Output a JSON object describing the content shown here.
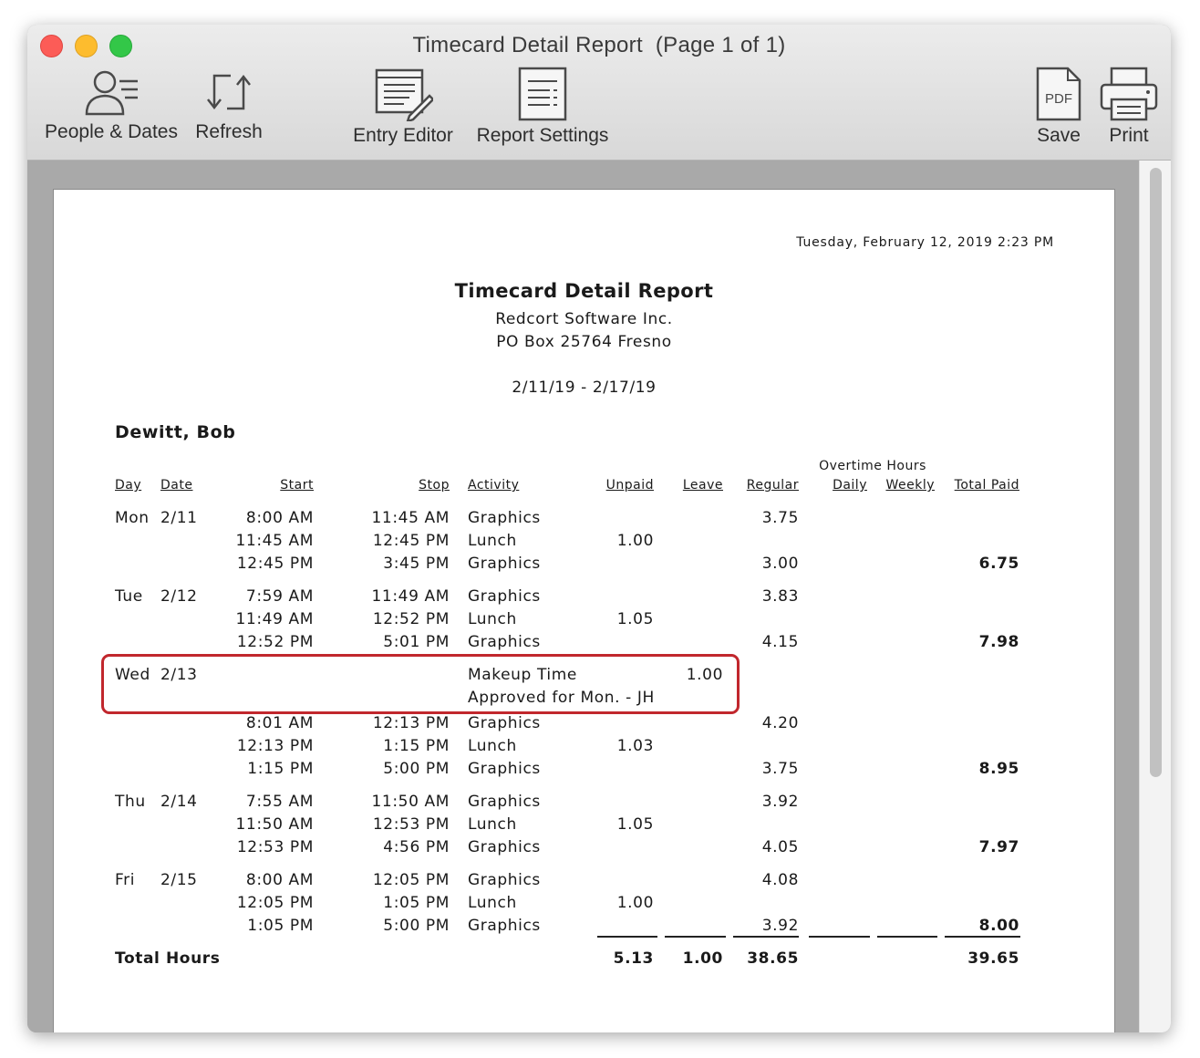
{
  "window": {
    "title": "Timecard Detail Report  (Page 1 of 1)"
  },
  "toolbar": {
    "people_dates": "People & Dates",
    "refresh": "Refresh",
    "entry_editor": "Entry Editor",
    "report_settings": "Report Settings",
    "pdf_badge": "PDF",
    "save": "Save",
    "print": "Print"
  },
  "report": {
    "timestamp": "Tuesday, February 12, 2019  2:23 PM",
    "title": "Timecard Detail Report",
    "company": "Redcort Software Inc.",
    "address": "PO Box 25764  Fresno",
    "date_range": "2/11/19 - 2/17/19",
    "employee": "Dewitt, Bob",
    "overtime_header": "Overtime Hours",
    "columns": {
      "day": "Day",
      "date": "Date",
      "start": "Start",
      "stop": "Stop",
      "activity": "Activity",
      "unpaid": "Unpaid",
      "leave": "Leave",
      "regular": "Regular",
      "daily": "Daily",
      "weekly": "Weekly",
      "total_paid": "Total Paid"
    },
    "rows": [
      {
        "day": "Mon",
        "date": "2/11",
        "start": "8:00 AM",
        "stop": "11:45 AM",
        "activity": "Graphics",
        "unpaid": "",
        "leave": "",
        "regular": "3.75",
        "total": ""
      },
      {
        "day": "",
        "date": "",
        "start": "11:45 AM",
        "stop": "12:45 PM",
        "activity": "Lunch",
        "unpaid": "1.00",
        "leave": "",
        "regular": "",
        "total": ""
      },
      {
        "day": "",
        "date": "",
        "start": "12:45 PM",
        "stop": "3:45 PM",
        "activity": "Graphics",
        "unpaid": "",
        "leave": "",
        "regular": "3.00",
        "total": "6.75"
      },
      {
        "day": "Tue",
        "date": "2/12",
        "start": "7:59 AM",
        "stop": "11:49 AM",
        "activity": "Graphics",
        "unpaid": "",
        "leave": "",
        "regular": "3.83",
        "total": ""
      },
      {
        "day": "",
        "date": "",
        "start": "11:49 AM",
        "stop": "12:52 PM",
        "activity": "Lunch",
        "unpaid": "1.05",
        "leave": "",
        "regular": "",
        "total": ""
      },
      {
        "day": "",
        "date": "",
        "start": "12:52 PM",
        "stop": "5:01 PM",
        "activity": "Graphics",
        "unpaid": "",
        "leave": "",
        "regular": "4.15",
        "total": "7.98"
      },
      {
        "day": "Wed",
        "date": "2/13",
        "start": "",
        "stop": "",
        "activity": "Makeup Time",
        "unpaid": "",
        "leave": "1.00",
        "regular": "",
        "total": ""
      },
      {
        "day": "",
        "date": "",
        "start": "",
        "stop": "",
        "activity": "Approved for Mon. - JH",
        "unpaid": "",
        "leave": "",
        "regular": "",
        "total": ""
      },
      {
        "day": "",
        "date": "",
        "start": "8:01 AM",
        "stop": "12:13 PM",
        "activity": "Graphics",
        "unpaid": "",
        "leave": "",
        "regular": "4.20",
        "total": ""
      },
      {
        "day": "",
        "date": "",
        "start": "12:13 PM",
        "stop": "1:15 PM",
        "activity": "Lunch",
        "unpaid": "1.03",
        "leave": "",
        "regular": "",
        "total": ""
      },
      {
        "day": "",
        "date": "",
        "start": "1:15 PM",
        "stop": "5:00 PM",
        "activity": "Graphics",
        "unpaid": "",
        "leave": "",
        "regular": "3.75",
        "total": "8.95"
      },
      {
        "day": "Thu",
        "date": "2/14",
        "start": "7:55 AM",
        "stop": "11:50 AM",
        "activity": "Graphics",
        "unpaid": "",
        "leave": "",
        "regular": "3.92",
        "total": ""
      },
      {
        "day": "",
        "date": "",
        "start": "11:50 AM",
        "stop": "12:53 PM",
        "activity": "Lunch",
        "unpaid": "1.05",
        "leave": "",
        "regular": "",
        "total": ""
      },
      {
        "day": "",
        "date": "",
        "start": "12:53 PM",
        "stop": "4:56 PM",
        "activity": "Graphics",
        "unpaid": "",
        "leave": "",
        "regular": "4.05",
        "total": "7.97"
      },
      {
        "day": "Fri",
        "date": "2/15",
        "start": "8:00 AM",
        "stop": "12:05 PM",
        "activity": "Graphics",
        "unpaid": "",
        "leave": "",
        "regular": "4.08",
        "total": ""
      },
      {
        "day": "",
        "date": "",
        "start": "12:05 PM",
        "stop": "1:05 PM",
        "activity": "Lunch",
        "unpaid": "1.00",
        "leave": "",
        "regular": "",
        "total": ""
      },
      {
        "day": "",
        "date": "",
        "start": "1:05 PM",
        "stop": "5:00 PM",
        "activity": "Graphics",
        "unpaid": "",
        "leave": "",
        "regular": "3.92",
        "total": "8.00"
      }
    ],
    "totals": {
      "label": "Total Hours",
      "unpaid": "5.13",
      "leave": "1.00",
      "regular": "38.65",
      "total_paid": "39.65"
    },
    "highlight_color": "#c1272d"
  }
}
